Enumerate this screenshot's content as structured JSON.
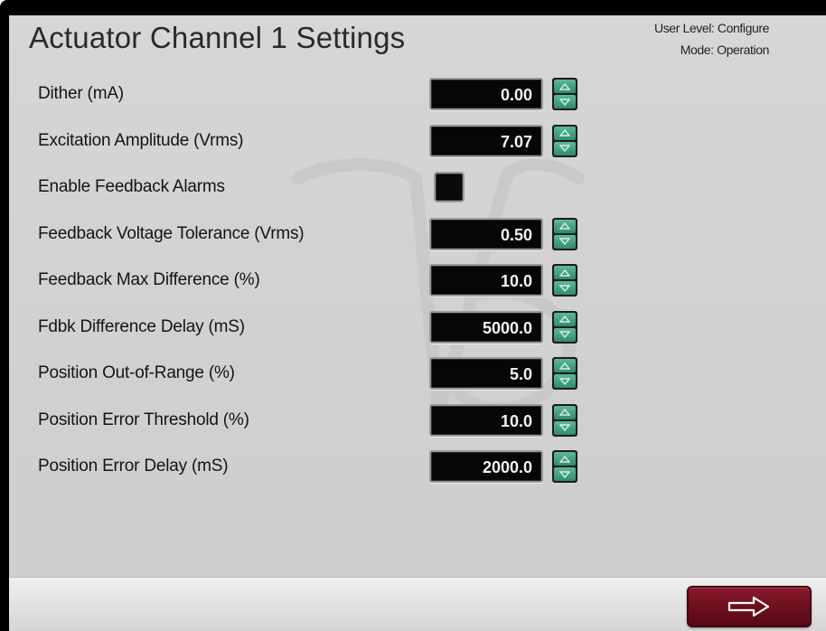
{
  "header": {
    "title": "Actuator Channel 1 Settings",
    "user_level": "User Level: Configure",
    "mode": "Mode: Operation"
  },
  "settings": [
    {
      "label": "Dither (mA)",
      "type": "numeric",
      "value": "0.00"
    },
    {
      "label": "Excitation Amplitude (Vrms)",
      "type": "numeric",
      "value": "7.07"
    },
    {
      "label": "Enable Feedback Alarms",
      "type": "checkbox",
      "checked": false
    },
    {
      "label": "Feedback Voltage Tolerance (Vrms)",
      "type": "numeric",
      "value": "0.50"
    },
    {
      "label": "Feedback Max Difference (%)",
      "type": "numeric",
      "value": "10.0"
    },
    {
      "label": "Fdbk Difference Delay (mS)",
      "type": "numeric",
      "value": "5000.0"
    },
    {
      "label": "Position Out-of-Range (%)",
      "type": "numeric",
      "value": "5.0"
    },
    {
      "label": "Position Error Threshold (%)",
      "type": "numeric",
      "value": "10.0"
    },
    {
      "label": "Position Error Delay (mS)",
      "type": "numeric",
      "value": "2000.0"
    }
  ],
  "icons": {
    "spinner_up": "triangle-up-icon",
    "spinner_down": "triangle-down-icon",
    "next": "arrow-right-icon"
  },
  "colors": {
    "next_button": "#7a1424",
    "spinner": "#3fa084",
    "value_box": "#060606"
  }
}
